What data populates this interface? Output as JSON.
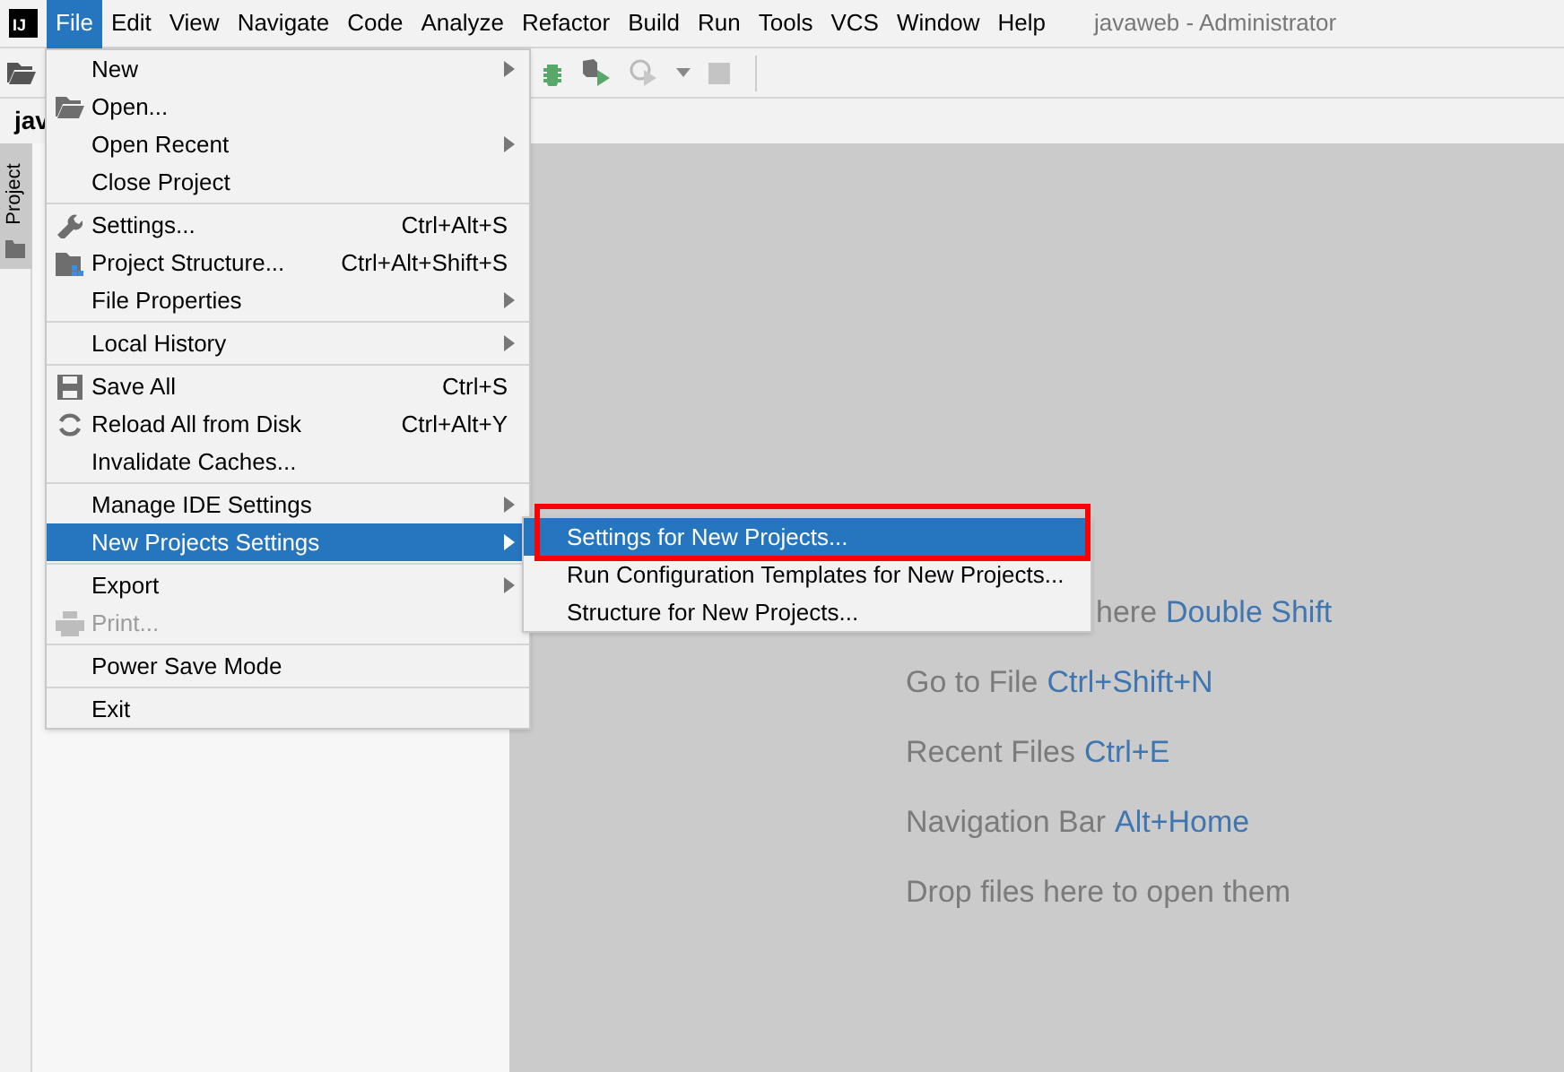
{
  "logo": "IJ",
  "menu_bar": [
    {
      "label": "File",
      "selected": true
    },
    {
      "label": "Edit",
      "selected": false
    },
    {
      "label": "View",
      "selected": false
    },
    {
      "label": "Navigate",
      "selected": false
    },
    {
      "label": "Code",
      "selected": false
    },
    {
      "label": "Analyze",
      "selected": false
    },
    {
      "label": "Refactor",
      "selected": false
    },
    {
      "label": "Build",
      "selected": false
    },
    {
      "label": "Run",
      "selected": false
    },
    {
      "label": "Tools",
      "selected": false
    },
    {
      "label": "VCS",
      "selected": false
    },
    {
      "label": "Window",
      "selected": false
    },
    {
      "label": "Help",
      "selected": false
    }
  ],
  "window_title": "javaweb - Administrator",
  "editor_tab": "jav",
  "side_tab": "Project",
  "file_menu": [
    [
      {
        "label": "New",
        "submenu": true,
        "disabled": false,
        "selected": false
      },
      {
        "label": "Open...",
        "kind": "folder",
        "submenu": false,
        "disabled": false,
        "selected": false
      },
      {
        "label": "Open Recent",
        "submenu": true,
        "disabled": false,
        "selected": false
      },
      {
        "label": "Close Project",
        "submenu": false,
        "disabled": false,
        "selected": false
      }
    ],
    [
      {
        "label": "Settings...",
        "kind": "wrench",
        "shortcut": "Ctrl+Alt+S",
        "submenu": false,
        "disabled": false,
        "selected": false
      },
      {
        "label": "Project Structure...",
        "kind": "structure",
        "shortcut": "Ctrl+Alt+Shift+S",
        "submenu": false,
        "disabled": false,
        "selected": false
      },
      {
        "label": "File Properties",
        "submenu": true,
        "disabled": false,
        "selected": false
      }
    ],
    [
      {
        "label": "Local History",
        "submenu": true,
        "disabled": false,
        "selected": false
      }
    ],
    [
      {
        "label": "Save All",
        "kind": "save",
        "shortcut": "Ctrl+S",
        "submenu": false,
        "disabled": false,
        "selected": false
      },
      {
        "label": "Reload All from Disk",
        "kind": "reload",
        "shortcut": "Ctrl+Alt+Y",
        "submenu": false,
        "disabled": false,
        "selected": false
      },
      {
        "label": "Invalidate Caches...",
        "submenu": false,
        "disabled": false,
        "selected": false
      }
    ],
    [
      {
        "label": "Manage IDE Settings",
        "submenu": true,
        "disabled": false,
        "selected": false
      },
      {
        "label": "New Projects Settings",
        "submenu": true,
        "disabled": false,
        "selected": true
      }
    ],
    [
      {
        "label": "Export",
        "submenu": true,
        "disabled": false,
        "selected": false
      },
      {
        "label": "Print...",
        "kind": "printer",
        "submenu": false,
        "disabled": true,
        "selected": false
      }
    ],
    [
      {
        "label": "Power Save Mode",
        "submenu": false,
        "disabled": false,
        "selected": false
      }
    ],
    [
      {
        "label": "Exit",
        "submenu": false,
        "disabled": false,
        "selected": false
      }
    ]
  ],
  "submenu": [
    {
      "label": "Settings for New Projects...",
      "selected": true,
      "highlighted_frame": true
    },
    {
      "label": "Run Configuration Templates for New Projects...",
      "selected": false,
      "highlighted_frame": false
    },
    {
      "label": "Structure for New Projects...",
      "selected": false,
      "highlighted_frame": false
    }
  ],
  "hints": [
    {
      "text": "here",
      "shortcut": "Double Shift",
      "partly_covered": true
    },
    {
      "text": "Go to File",
      "shortcut": "Ctrl+Shift+N",
      "partly_covered": false
    },
    {
      "text": "Recent Files",
      "shortcut": "Ctrl+E",
      "partly_covered": false
    },
    {
      "text": "Navigation Bar",
      "shortcut": "Alt+Home",
      "partly_covered": false
    },
    {
      "text": "Drop files here to open them",
      "partly_covered": false
    }
  ]
}
